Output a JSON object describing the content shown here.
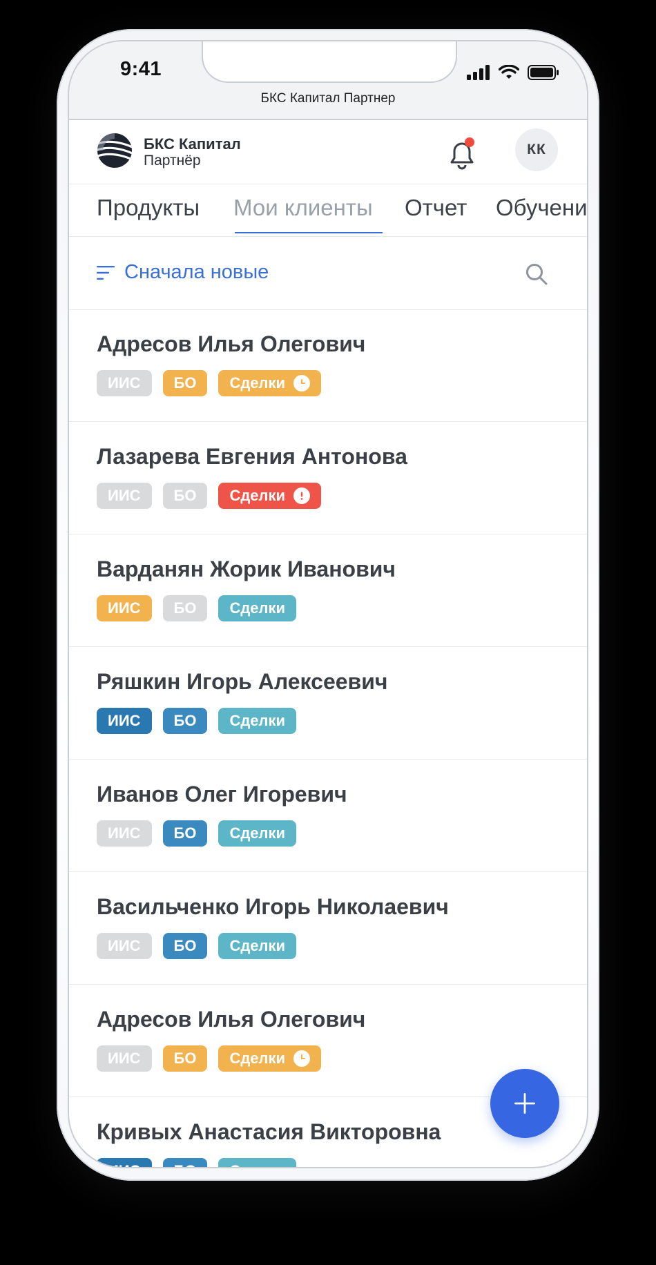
{
  "status_bar": {
    "time": "9:41"
  },
  "browser": {
    "title": "БКС Капитал Партнер"
  },
  "header": {
    "brand_line1": "БКС Капитал",
    "brand_line2": "Партнёр",
    "avatar_initials": "КК",
    "has_notification": true
  },
  "tabs": [
    {
      "label": "Продукты",
      "active": false
    },
    {
      "label": "Мои клиенты",
      "active": true
    },
    {
      "label": "Отчет",
      "active": false
    },
    {
      "label": "Обучение",
      "active": false
    }
  ],
  "filter": {
    "sort_label": "Сначала новые"
  },
  "badge_labels": {
    "iis": "ИИС",
    "bo": "БО",
    "deals": "Сделки"
  },
  "colors": {
    "accent": "#3766e3",
    "grey": "#d9dadc",
    "orange": "#f2b34f",
    "red": "#ee5447",
    "teal": "#5cb6c7",
    "blue": "#3a8abf"
  },
  "clients": [
    {
      "name": "Адресов Илья Олегович",
      "iis": "grey",
      "bo": "orange",
      "deals": "orange",
      "deals_icon": "clock-icon"
    },
    {
      "name": "Лазарева Евгения Антонова",
      "iis": "grey",
      "bo": "grey",
      "deals": "red",
      "deals_icon": "alert-icon"
    },
    {
      "name": "Варданян Жорик Иванович",
      "iis": "orange",
      "bo": "grey",
      "deals": "teal",
      "deals_icon": ""
    },
    {
      "name": "Ряшкин Игорь Алексеевич",
      "iis": "navy",
      "bo": "blue",
      "deals": "teal",
      "deals_icon": ""
    },
    {
      "name": "Иванов Олег Игоревич",
      "iis": "grey",
      "bo": "blue",
      "deals": "teal",
      "deals_icon": ""
    },
    {
      "name": "Васильченко Игорь Николаевич",
      "iis": "grey",
      "bo": "blue",
      "deals": "teal",
      "deals_icon": ""
    },
    {
      "name": "Адресов Илья Олегович",
      "iis": "grey",
      "bo": "orange",
      "deals": "orange",
      "deals_icon": "clock-icon"
    },
    {
      "name": "Кривых Анастасия Викторовна",
      "iis": "navy",
      "bo": "blue",
      "deals": "teal",
      "deals_icon": ""
    }
  ],
  "fab": {
    "icon": "plus-icon"
  }
}
